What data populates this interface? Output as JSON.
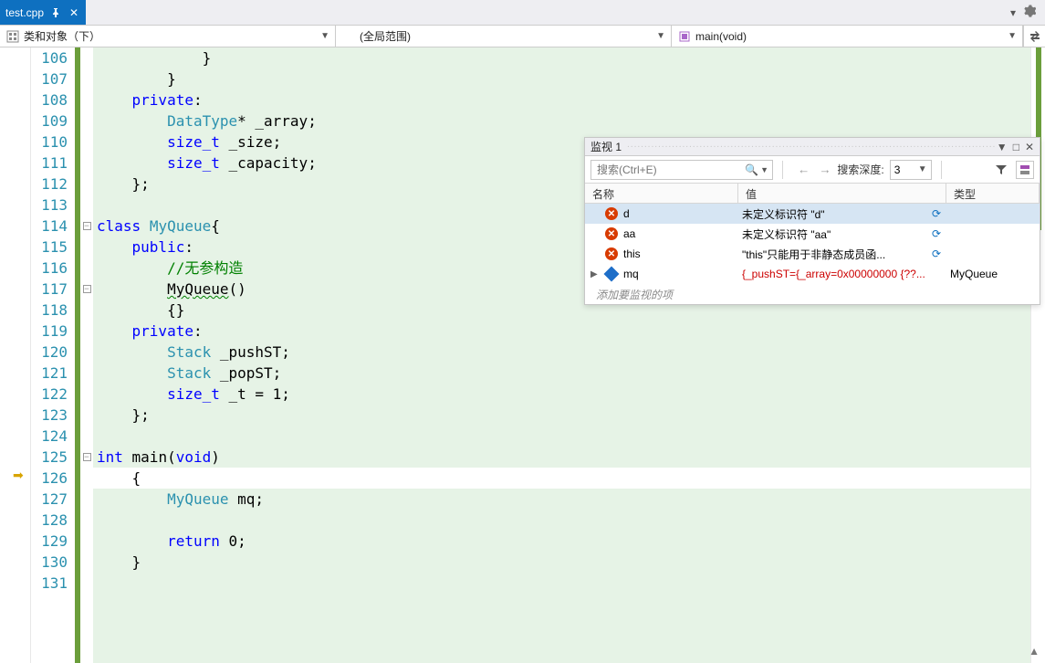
{
  "tab": {
    "filename": "test.cpp"
  },
  "nav": {
    "project": "类和对象（下）",
    "scope": "(全局范围)",
    "function": "main(void)"
  },
  "chart_data": {
    "type": "table",
    "title": "code-listing",
    "lines": [
      {
        "n": 106,
        "t": "            }"
      },
      {
        "n": 107,
        "t": "        }"
      },
      {
        "n": 108,
        "t": "    private:",
        "kw": [
          "private"
        ]
      },
      {
        "n": 109,
        "t": "        DataType* _array;",
        "typ": [
          "DataType"
        ]
      },
      {
        "n": 110,
        "t": "        size_t _size;",
        "kw": [
          "size_t"
        ]
      },
      {
        "n": 111,
        "t": "        size_t _capacity;",
        "kw": [
          "size_t"
        ]
      },
      {
        "n": 112,
        "t": "    };"
      },
      {
        "n": 113,
        "t": ""
      },
      {
        "n": 114,
        "t": "class MyQueue{",
        "kw": [
          "class"
        ],
        "typ": [
          "MyQueue"
        ],
        "fold": "-"
      },
      {
        "n": 115,
        "t": "    public:",
        "kw": [
          "public"
        ]
      },
      {
        "n": 116,
        "t": "        //无参构造",
        "cm": true
      },
      {
        "n": 117,
        "t": "        MyQueue()",
        "underline": "MyQueue",
        "fold": "-"
      },
      {
        "n": 118,
        "t": "        {}"
      },
      {
        "n": 119,
        "t": "    private:",
        "kw": [
          "private"
        ]
      },
      {
        "n": 120,
        "t": "        Stack _pushST;",
        "typ": [
          "Stack"
        ]
      },
      {
        "n": 121,
        "t": "        Stack _popST;",
        "typ": [
          "Stack"
        ]
      },
      {
        "n": 122,
        "t": "        size_t _t = 1;",
        "kw": [
          "size_t"
        ]
      },
      {
        "n": 123,
        "t": "    };"
      },
      {
        "n": 124,
        "t": ""
      },
      {
        "n": 125,
        "t": "int main(void)",
        "kw": [
          "int",
          "void"
        ],
        "fold": "-"
      },
      {
        "n": 126,
        "t": "    {",
        "current": true,
        "bp": true
      },
      {
        "n": 127,
        "t": "        MyQueue mq;",
        "typ": [
          "MyQueue"
        ]
      },
      {
        "n": 128,
        "t": ""
      },
      {
        "n": 129,
        "t": "        return 0;",
        "kw": [
          "return"
        ]
      },
      {
        "n": 130,
        "t": "    }"
      },
      {
        "n": 131,
        "t": ""
      }
    ]
  },
  "watch": {
    "title": "监视 1",
    "search_placeholder": "搜索(Ctrl+E)",
    "depth_label": "搜索深度:",
    "depth_value": "3",
    "columns": {
      "name": "名称",
      "value": "值",
      "type": "类型"
    },
    "add_label": "添加要监视的项",
    "rows": [
      {
        "icon": "error",
        "name": "d",
        "value": "未定义标识符 \"d\"",
        "type": "",
        "refresh": true,
        "selected": true
      },
      {
        "icon": "error",
        "name": "aa",
        "value": "未定义标识符 \"aa\"",
        "type": "",
        "refresh": true
      },
      {
        "icon": "error",
        "name": "this",
        "value": "\"this\"只能用于非静态成员函...",
        "type": "",
        "refresh": true
      },
      {
        "icon": "object",
        "name": "mq",
        "value": "{_pushST={_array=0x00000000 {??...",
        "value_class": "val-err",
        "type": "MyQueue",
        "expandable": true
      }
    ]
  }
}
